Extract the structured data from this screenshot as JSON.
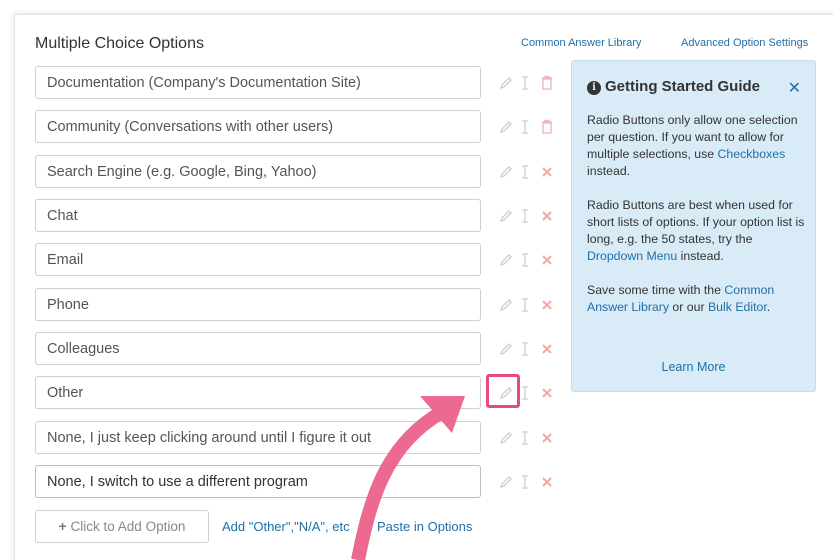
{
  "section_title": "Multiple Choice Options",
  "header_links": {
    "common_answer_library": "Common Answer Library",
    "advanced_option_settings": "Advanced Option Settings"
  },
  "options": [
    {
      "value": "Documentation (Company's Documentation Site)",
      "delete_icon": "trash-icon"
    },
    {
      "value": "Community (Conversations with other users)",
      "delete_icon": "trash-icon"
    },
    {
      "value": "Search Engine (e.g. Google, Bing, Yahoo)",
      "delete_icon": "close-icon"
    },
    {
      "value": "Chat",
      "delete_icon": "close-icon"
    },
    {
      "value": "Email",
      "delete_icon": "close-icon"
    },
    {
      "value": "Phone",
      "delete_icon": "close-icon"
    },
    {
      "value": "Colleagues",
      "delete_icon": "close-icon"
    },
    {
      "value": "Other",
      "delete_icon": "close-icon"
    },
    {
      "value": "None, I just keep clicking around until I figure it out",
      "delete_icon": "close-icon"
    },
    {
      "value": "None, I switch to use a different program",
      "delete_icon": "close-icon"
    }
  ],
  "guide": {
    "title": "Getting Started Guide",
    "p1_text": "Radio Buttons only allow one selection per question. If you want to allow for multiple selections, use ",
    "p1_link": "Checkboxes",
    "p1_end": " instead.",
    "p2_text": "Radio Buttons are best when used for short lists of options. If your option list is long, e.g. the 50 states, try the ",
    "p2_link": "Dropdown Menu",
    "p2_end": " instead.",
    "p3_text": "Save some time with the ",
    "p3_link1": "Common Answer Library",
    "p3_mid": " or our ",
    "p3_link2": "Bulk Editor",
    "p3_end": ".",
    "learn_more": "Learn More"
  },
  "footer": {
    "add_option": "Click to Add Option",
    "add_other": "Add \"Other\",\"N/A\", etc",
    "paste_options": "Paste in Options"
  },
  "colors": {
    "link": "#1e6fa8",
    "guide_bg": "#d9ebf7",
    "highlight": "#e84a7a",
    "delete_x": "#f0a8a8"
  }
}
